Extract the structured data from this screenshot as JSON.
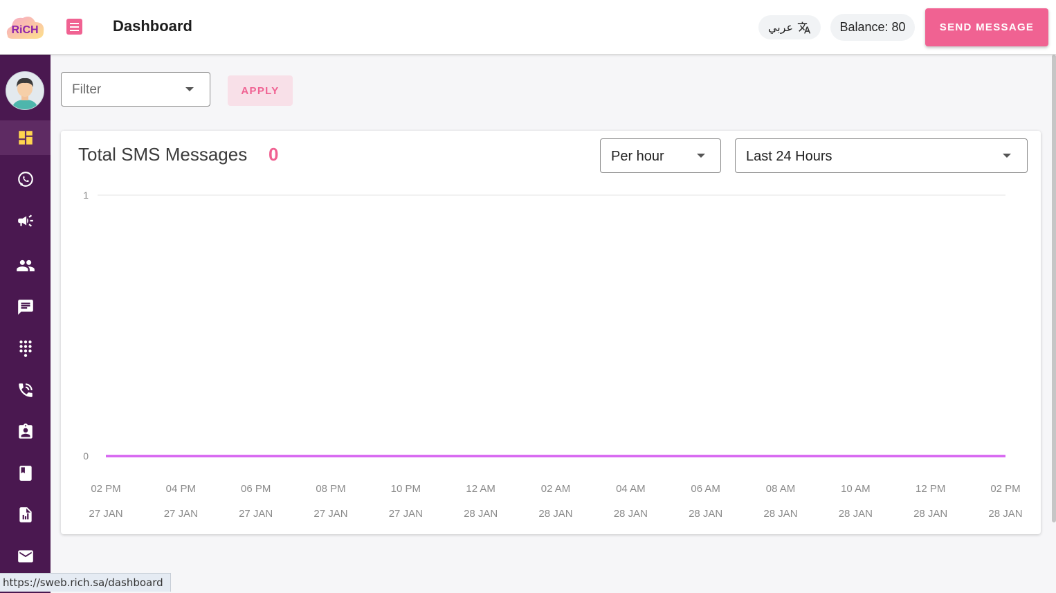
{
  "header": {
    "logo_text": "RiCH",
    "title": "Dashboard",
    "language_label": "عربي",
    "language_icon": "translate-icon",
    "balance": "Balance: 80",
    "send_button": "SEND MESSAGE"
  },
  "sidebar": {
    "items": [
      {
        "icon": "dashboard-icon",
        "active": true
      },
      {
        "icon": "whatsapp-icon",
        "active": false
      },
      {
        "icon": "megaphone-icon",
        "active": false
      },
      {
        "icon": "contacts-group-icon",
        "active": false
      },
      {
        "icon": "chat-message-icon",
        "active": false
      },
      {
        "icon": "dialpad-icon",
        "active": false
      },
      {
        "icon": "phone-call-icon",
        "active": false
      },
      {
        "icon": "clipboard-contact-icon",
        "active": false
      },
      {
        "icon": "book-icon",
        "active": false
      },
      {
        "icon": "report-chart-icon",
        "active": false
      },
      {
        "icon": "email-icon",
        "active": false
      }
    ]
  },
  "filter": {
    "placeholder": "Filter",
    "apply_label": "APPLY"
  },
  "card": {
    "title": "Total SMS Messages",
    "count": "0",
    "interval_select": "Per hour",
    "range_select": "Last 24 Hours"
  },
  "chart_data": {
    "type": "line",
    "x_time": [
      "02 PM",
      "04 PM",
      "06 PM",
      "08 PM",
      "10 PM",
      "12 AM",
      "02 AM",
      "04 AM",
      "06 AM",
      "08 AM",
      "10 AM",
      "12 PM",
      "02 PM"
    ],
    "x_date": [
      "27 JAN",
      "27 JAN",
      "27 JAN",
      "27 JAN",
      "27 JAN",
      "28 JAN",
      "28 JAN",
      "28 JAN",
      "28 JAN",
      "28 JAN",
      "28 JAN",
      "28 JAN",
      "28 JAN"
    ],
    "y_ticks": [
      "1",
      "0"
    ],
    "ylim": [
      0,
      1
    ],
    "series": [
      {
        "values": [
          0,
          0,
          0,
          0,
          0,
          0,
          0,
          0,
          0,
          0,
          0,
          0,
          0
        ],
        "color": "#d45cf0"
      }
    ],
    "grid": true,
    "title": "",
    "xlabel": "",
    "ylabel": ""
  },
  "status_url": "https://sweb.rich.sa/dashboard",
  "colors": {
    "accent": "#f06292",
    "sidebar": "#4a1850",
    "line": "#d45cf0"
  }
}
